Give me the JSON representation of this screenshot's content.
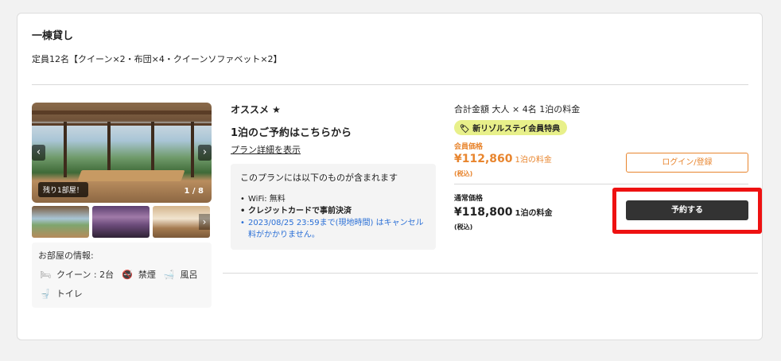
{
  "room": {
    "title": "一棟貸し",
    "capacity": "定員12名【クイーン×2・布団×4・クイーンソファベット×2】"
  },
  "gallery": {
    "remaining_badge": "残り1部屋！",
    "counter": "1 / 8",
    "prev_icon": "‹",
    "next_icon": "›"
  },
  "room_info": {
    "title": "お部屋の情報:",
    "amenities": [
      {
        "icon": "bed-icon",
        "label": "クイーン : 2台"
      },
      {
        "icon": "no-smoking-icon",
        "label": "禁煙"
      },
      {
        "icon": "bath-icon",
        "label": "風呂"
      },
      {
        "icon": "toilet-icon",
        "label": "トイレ"
      }
    ]
  },
  "plan": {
    "recommend": "オススメ ★",
    "name": "1泊のご予約はこちらから",
    "detail_link": "プラン詳細を表示",
    "includes_title": "このプランには以下のものが含まれます",
    "includes": [
      "WiFi: 無料",
      "クレジットカードで事前決済"
    ],
    "cancel_notice": "2023/08/25 23:59まで(現地時間) はキャンセル料がかかりません。"
  },
  "price": {
    "total_label": "合計金額 大人 × 4名 1泊の料金",
    "member_tag": "新リゾルステイ会員特典",
    "member_label": "会員価格",
    "member_amount": "¥112,860",
    "member_per": "1泊の料金",
    "member_tax": "(税込)",
    "regular_label": "通常価格",
    "regular_amount": "¥118,800",
    "regular_per": "1泊の料金",
    "regular_tax": "(税込)",
    "login_button": "ログイン/登録",
    "reserve_button": "予約する"
  },
  "colors": {
    "accent_orange": "#e8852e",
    "member_tag_bg": "#e8f08a",
    "highlight_red": "#ee1111",
    "reserve_bg": "#333333",
    "link_blue": "#2a6fd6"
  }
}
